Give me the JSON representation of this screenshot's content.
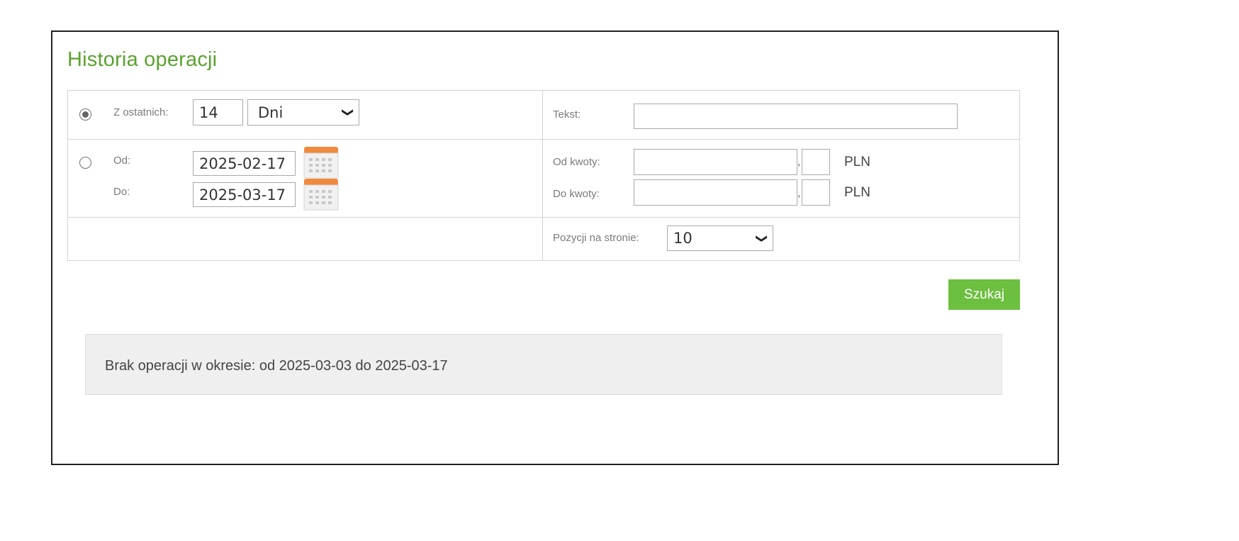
{
  "page": {
    "title": "Historia operacji"
  },
  "period": {
    "last_label": "Z ostatnich:",
    "last_value": "14",
    "unit_selected": "Dni",
    "last_checked": true,
    "from_label": "Od:",
    "from_value": "2025-02-17",
    "to_label": "Do:",
    "to_value": "2025-03-17",
    "range_checked": false
  },
  "filters": {
    "text_label": "Tekst:",
    "text_value": "",
    "from_amount_label": "Od kwoty:",
    "to_amount_label": "Do kwoty:",
    "from_amount_int": "",
    "from_amount_dec": "",
    "to_amount_int": "",
    "to_amount_dec": "",
    "separator": ",",
    "currency": "PLN",
    "per_page_label": "Pozycji na stronie:",
    "per_page_value": "10"
  },
  "search_button": "Szukaj",
  "result_message": "Brak operacji w okresie: od 2025-03-03 do 2025-03-17",
  "colors": {
    "accent": "#6cbf3f",
    "title": "#5aa32f",
    "calendar": "#f08a3c"
  },
  "icons": [
    "calendar-icon",
    "chevron-down-icon"
  ]
}
